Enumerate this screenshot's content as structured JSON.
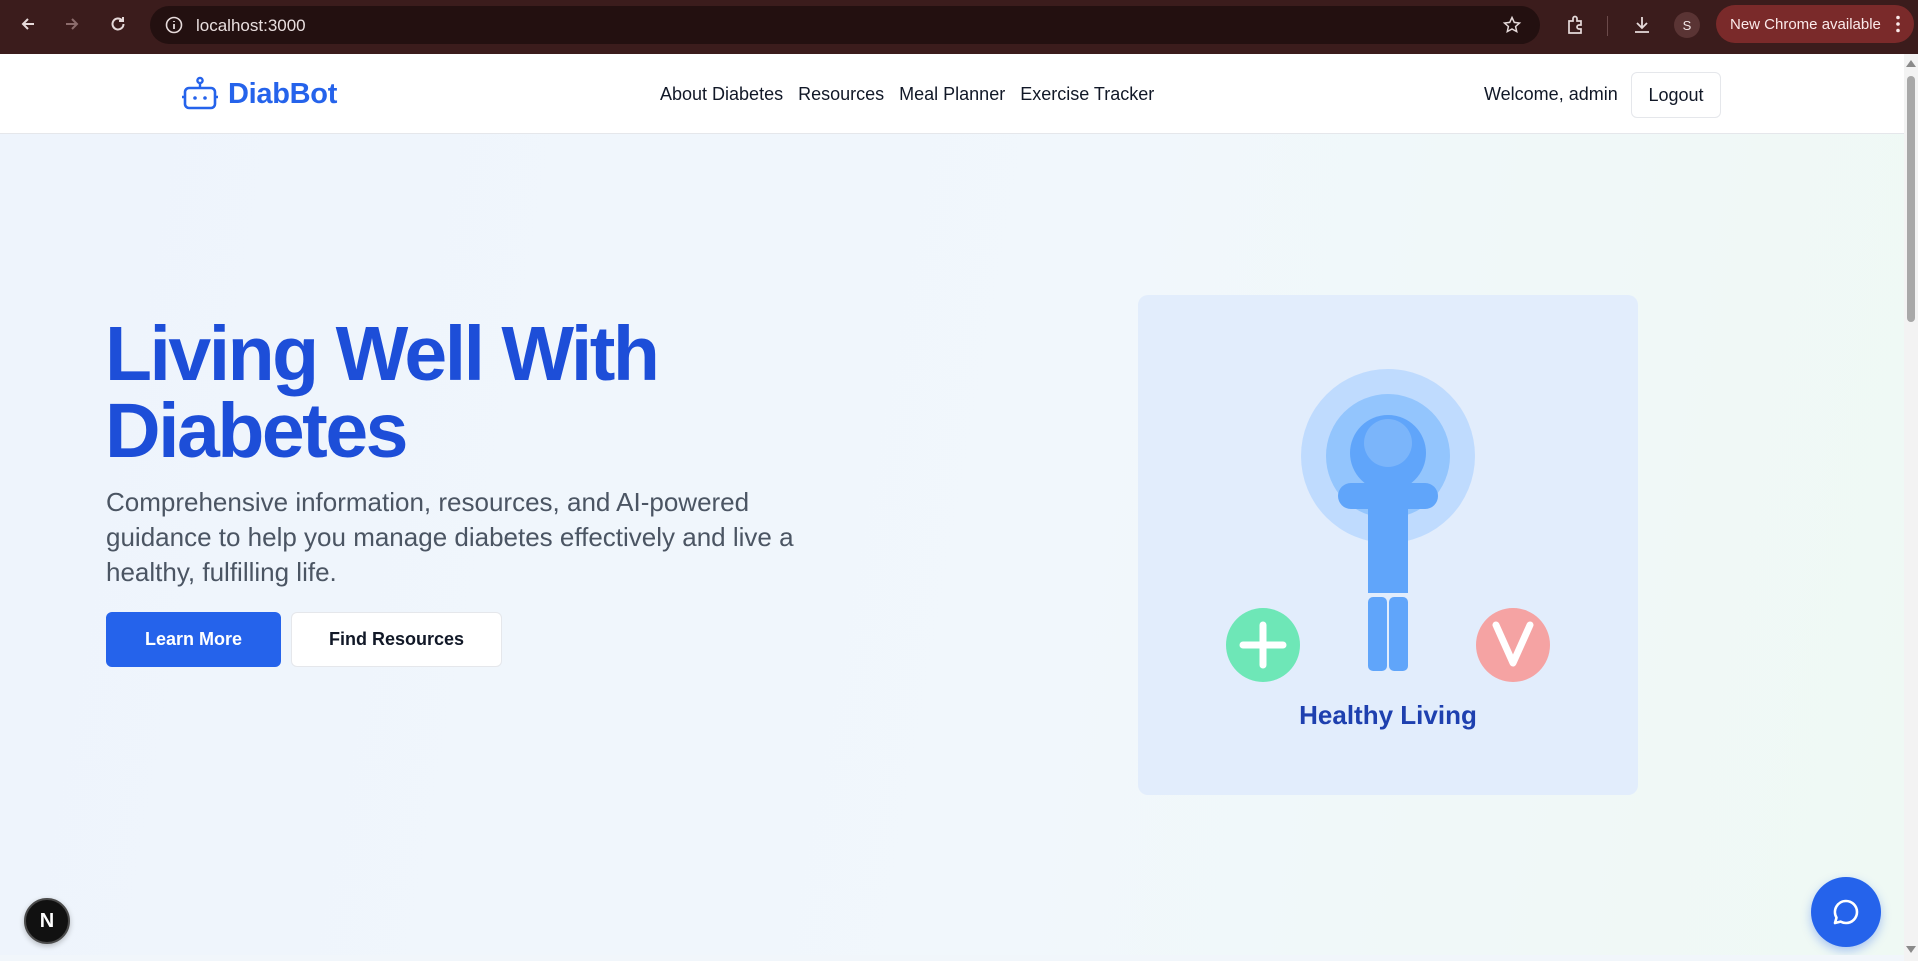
{
  "browser": {
    "url": "localhost:3000",
    "profile_initial": "S",
    "update_label": "New Chrome available",
    "icons": [
      "back-icon",
      "forward-icon",
      "reload-icon",
      "info-icon",
      "star-icon",
      "extensions-icon",
      "download-icon",
      "more-icon"
    ]
  },
  "header": {
    "brand": "DiabBot",
    "nav": [
      "About Diabetes",
      "Resources",
      "Meal Planner",
      "Exercise Tracker"
    ],
    "welcome": "Welcome, admin",
    "logout_label": "Logout"
  },
  "hero": {
    "title_line1": "Living Well With",
    "title_line2": "Diabetes",
    "subtitle": "Comprehensive information, resources, and AI-powered guidance to help you manage diabetes effectively and live a healthy, fulfilling life.",
    "primary_button": "Learn More",
    "secondary_button": "Find Resources"
  },
  "illustration": {
    "caption": "Healthy Living",
    "colors": {
      "card": "#e2edfc",
      "halo_outer": "#bfdbfe",
      "halo_inner": "#93c5fd",
      "figure": "#60a5fa",
      "plus": "#6ee7b7",
      "heart": "#f5a3a3"
    }
  },
  "floating": {
    "dev_badge": "N",
    "chat_icon": "chat-bubble-icon"
  },
  "colors": {
    "brand": "#2563eb",
    "title": "#1d4ed8",
    "chrome": "#3b1c1c"
  }
}
